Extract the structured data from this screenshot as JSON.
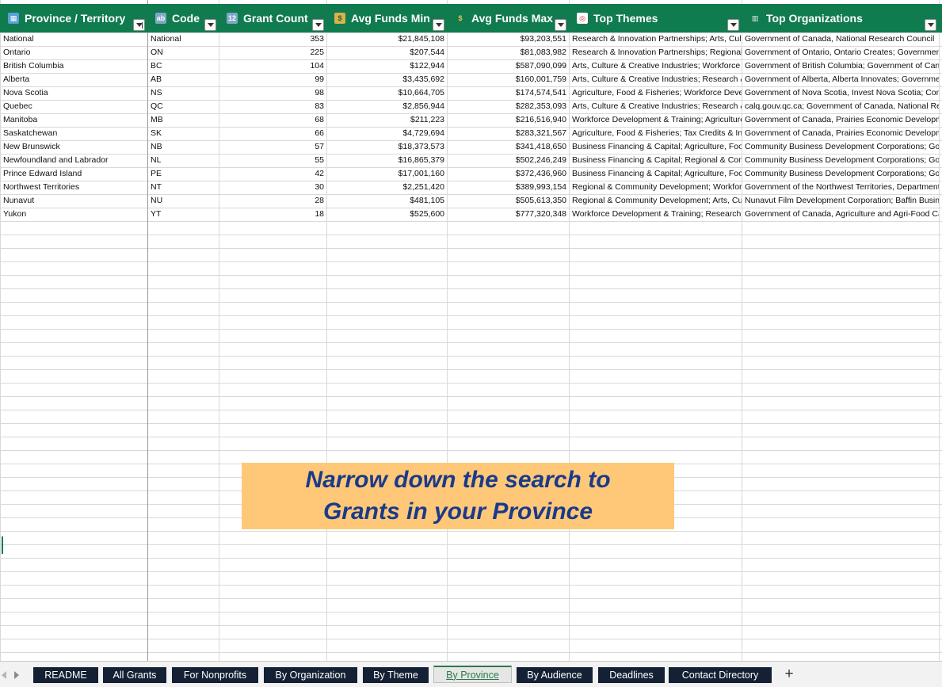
{
  "sheet": {
    "columns": [
      {
        "label": "Province / Territory",
        "icon": "map-icon",
        "filter": "active"
      },
      {
        "label": "Code",
        "icon": "abc-icon",
        "filter": "dropdown"
      },
      {
        "label": "Grant Count",
        "icon": "numbers-icon",
        "filter": "dropdown"
      },
      {
        "label": "Avg Funds Min",
        "icon": "money-icon",
        "filter": "dropdown"
      },
      {
        "label": "Avg Funds Max",
        "icon": "money-bag-icon",
        "filter": "dropdown"
      },
      {
        "label": "Top Themes",
        "icon": "target-icon",
        "filter": "dropdown"
      },
      {
        "label": "Top Organizations",
        "icon": "building-icon",
        "filter": "dropdown"
      }
    ],
    "rows": [
      [
        "National",
        "National",
        "353",
        "$21,845,108",
        "$93,203,551",
        "Research & Innovation Partnerships; Arts, Culture & Creative Industries",
        "Government of Canada, National Research Council"
      ],
      [
        "Ontario",
        "ON",
        "225",
        "$207,544",
        "$81,083,982",
        "Research & Innovation Partnerships; Regional & Community Development",
        "Government of Ontario, Ontario Creates; Government of Canada"
      ],
      [
        "British Columbia",
        "BC",
        "104",
        "$122,944",
        "$587,090,099",
        "Arts, Culture & Creative Industries; Workforce Development & Training",
        "Government of British Columbia; Government of Canada"
      ],
      [
        "Alberta",
        "AB",
        "99",
        "$3,435,692",
        "$160,001,759",
        "Arts, Culture & Creative Industries; Research & Innovation Partnerships",
        "Government of Alberta, Alberta Innovates; Government of Canada"
      ],
      [
        "Nova Scotia",
        "NS",
        "98",
        "$10,664,705",
        "$174,574,541",
        "Agriculture, Food & Fisheries; Workforce Development & Training",
        "Government of Nova Scotia, Invest Nova Scotia; Community Business Development Corporations"
      ],
      [
        "Quebec",
        "QC",
        "83",
        "$2,856,944",
        "$282,353,093",
        "Arts, Culture & Creative Industries; Research & Innovation Partnerships",
        "calq.gouv.qc.ca; Government of Canada, National Research Council"
      ],
      [
        "Manitoba",
        "MB",
        "68",
        "$211,223",
        "$216,516,940",
        "Workforce Development & Training; Agriculture, Food & Fisheries",
        "Government of Canada, Prairies Economic Development Canada"
      ],
      [
        "Saskatchewan",
        "SK",
        "66",
        "$4,729,694",
        "$283,321,567",
        "Agriculture, Food & Fisheries; Tax Credits & Incentives",
        "Government of Canada, Prairies Economic Development Canada"
      ],
      [
        "New Brunswick",
        "NB",
        "57",
        "$18,373,573",
        "$341,418,650",
        "Business Financing & Capital; Agriculture, Food & Fisheries",
        "Community Business Development Corporations; Government of Canada"
      ],
      [
        "Newfoundland and Labrador",
        "NL",
        "55",
        "$16,865,379",
        "$502,246,249",
        "Business Financing & Capital; Regional & Community Development",
        "Community Business Development Corporations; Government of Canada"
      ],
      [
        "Prince Edward Island",
        "PE",
        "42",
        "$17,001,160",
        "$372,436,960",
        "Business Financing & Capital; Agriculture, Food & Fisheries",
        "Community Business Development Corporations; Government of Canada"
      ],
      [
        "Northwest Territories",
        "NT",
        "30",
        "$2,251,420",
        "$389,993,154",
        "Regional & Community Development; Workforce Development & Training",
        "Government of the Northwest Territories, Department of Industry"
      ],
      [
        "Nunavut",
        "NU",
        "28",
        "$481,105",
        "$505,613,350",
        "Regional & Community Development; Arts, Culture & Creative Industries",
        "Nunavut Film Development Corporation; Baffin Business Development Corporation"
      ],
      [
        "Yukon",
        "YT",
        "18",
        "$525,600",
        "$777,320,348",
        "Workforce Development & Training; Research & Innovation Partnerships",
        "Government of Canada, Agriculture and Agri-Food Canada"
      ]
    ]
  },
  "callout": {
    "line1": "Narrow down the search to",
    "line2": "Grants in your Province"
  },
  "tabs": [
    "README",
    "All Grants",
    "For Nonprofits",
    "By Organization",
    "By Theme",
    "By Province",
    "By Audience",
    "Deadlines",
    "Contact Directory"
  ],
  "active_tab": "By Province",
  "add_tab_label": "+",
  "colors": {
    "header_bg": "#0f7b4f",
    "callout_bg": "#ffc878",
    "callout_text": "#1a3a8a",
    "tab_bg": "#142033"
  }
}
